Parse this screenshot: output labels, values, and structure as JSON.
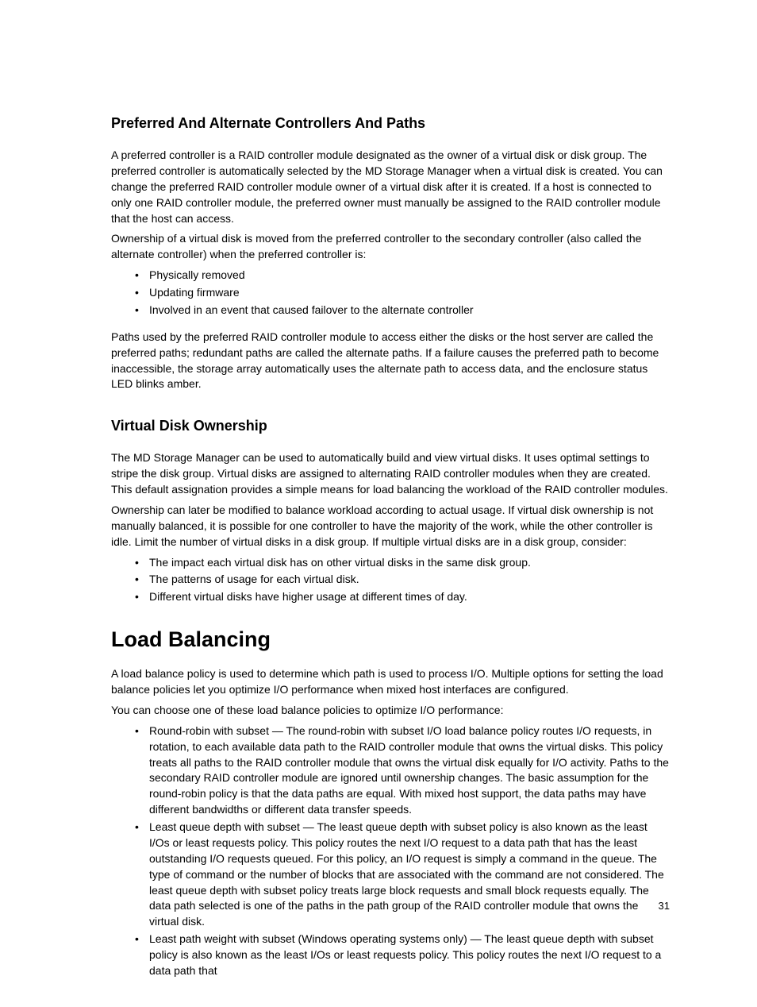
{
  "section1": {
    "heading": "Preferred And Alternate Controllers And Paths",
    "p1": "A preferred controller is a RAID controller module designated as the owner of a virtual disk or disk group. The preferred controller is automatically selected by the MD Storage Manager when a virtual disk is created. You can change the preferred RAID controller module owner of a virtual disk after it is created. If a host is connected to only one RAID controller module, the preferred owner must manually be assigned to the RAID controller module that the host can access.",
    "p2": "Ownership of a virtual disk is moved from the preferred controller to the secondary controller (also called the alternate controller) when the preferred controller is:",
    "bullets": [
      "Physically removed",
      "Updating firmware",
      "Involved in an event that caused failover to the alternate controller"
    ],
    "p3": "Paths used by the preferred RAID controller module to access either the disks or the host server are called the preferred paths; redundant paths are called the alternate paths. If a failure causes the preferred path to become inaccessible, the storage array automatically uses the alternate path to access data, and the enclosure status LED blinks amber."
  },
  "section2": {
    "heading": "Virtual Disk Ownership",
    "p1": "The MD Storage Manager can be used to automatically build and view virtual disks. It uses optimal settings to stripe the disk group. Virtual disks are assigned to alternating RAID controller modules when they are created. This default assignation provides a simple means for load balancing the workload of the RAID controller modules.",
    "p2": "Ownership can later be modified to balance workload according to actual usage. If virtual disk ownership is not manually balanced, it is possible for one controller to have the majority of the work, while the other controller is idle. Limit the number of virtual disks in a disk group. If multiple virtual disks are in a disk group, consider:",
    "bullets": [
      "The impact each virtual disk has on other virtual disks in the same disk group.",
      "The patterns of usage for each virtual disk.",
      "Different virtual disks have higher usage at different times of day."
    ]
  },
  "section3": {
    "heading": "Load Balancing",
    "p1": "A load balance policy is used to determine which path is used to process I/O. Multiple options for setting the load balance policies let you optimize I/O performance when mixed host interfaces are configured.",
    "p2": "You can choose one of these load balance policies to optimize I/O performance:",
    "bullets": [
      "Round-robin with subset — The round-robin with subset I/O load balance policy routes I/O requests, in rotation, to each available data path to the RAID controller module that owns the virtual disks. This policy treats all paths to the RAID controller module that owns the virtual disk equally for I/O activity. Paths to the secondary RAID controller module are ignored until ownership changes. The basic assumption for the round-robin policy is that the data paths are equal. With mixed host support, the data paths may have different bandwidths or different data transfer speeds.",
      "Least queue depth with subset — The least queue depth with subset policy is also known as the least I/Os or least requests policy. This policy routes the next I/O request to a data path that has the least outstanding I/O requests queued. For this policy, an I/O request is simply a command in the queue. The type of command or the number of blocks that are associated with the command are not considered. The least queue depth with subset policy treats large block requests and small block requests equally. The data path selected is one of the paths in the path group of the RAID controller module that owns the virtual disk.",
      "Least path weight with subset (Windows operating systems only) — The least queue depth with subset policy is also known as the least I/Os or least requests policy. This policy routes the next I/O request to a data path that"
    ]
  },
  "pageNumber": "31"
}
